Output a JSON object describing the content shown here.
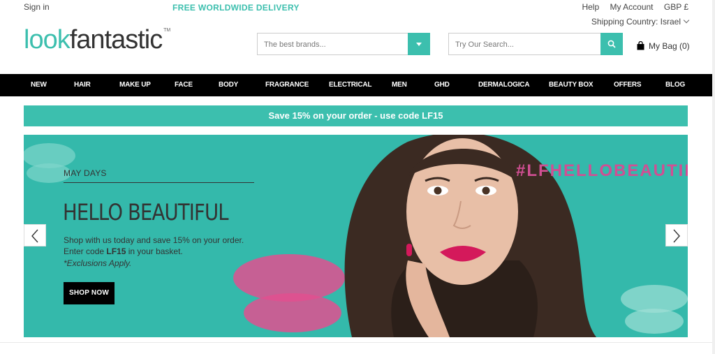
{
  "topbar": {
    "sign_in": "Sign in",
    "promo": "FREE WORLDWIDE DELIVERY",
    "help": "Help",
    "my_account": "My Account",
    "currency": "GBP £",
    "shipping_country": "Shipping Country: Israel"
  },
  "logo": {
    "look": "look",
    "fantastic": "fantastic",
    "tm": "TM"
  },
  "brand_select": {
    "placeholder": "The best brands..."
  },
  "search": {
    "placeholder": "Try Our Search..."
  },
  "bag": {
    "label": "My Bag (0)"
  },
  "nav": {
    "items": [
      "NEW",
      "HAIR",
      "MAKE UP",
      "FACE",
      "BODY",
      "FRAGRANCE",
      "ELECTRICAL",
      "MEN",
      "GHD",
      "DERMALOGICA",
      "BEAUTY BOX",
      "OFFERS",
      "BLOG"
    ]
  },
  "save_banner": {
    "text": "Save 15% on your order -  use code LF15"
  },
  "hero": {
    "eyebrow": "MAY DAYS",
    "title": "HELLO BEAUTIFUL",
    "body_pre": "Shop with us today and save 15% on your order. Enter code ",
    "body_code": "LF15",
    "body_post": " in your basket.",
    "note": "*Exclusions Apply.",
    "cta": "SHOP NOW",
    "hashtag": "#LFHELLOBEAUTIFUL"
  },
  "colors": {
    "accent": "#3cbfae",
    "hero_bg": "#34b9ab",
    "hashtag": "#d04f93",
    "nav_bg": "#000000"
  }
}
